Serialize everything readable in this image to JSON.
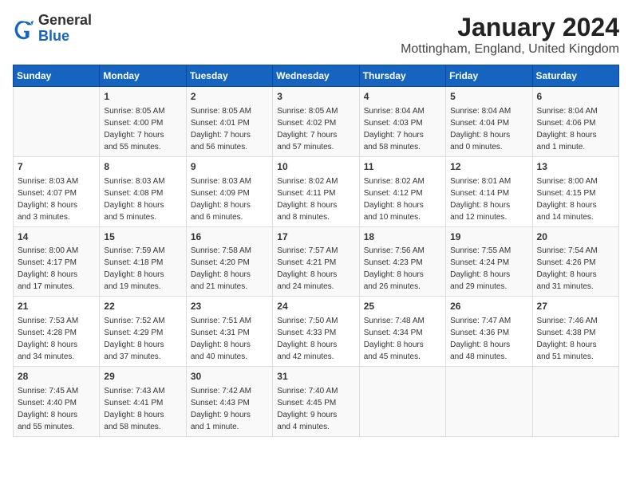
{
  "header": {
    "logo_general": "General",
    "logo_blue": "Blue",
    "month_title": "January 2024",
    "location": "Mottingham, England, United Kingdom"
  },
  "days_of_week": [
    "Sunday",
    "Monday",
    "Tuesday",
    "Wednesday",
    "Thursday",
    "Friday",
    "Saturday"
  ],
  "weeks": [
    [
      {
        "day": "",
        "info": ""
      },
      {
        "day": "1",
        "info": "Sunrise: 8:05 AM\nSunset: 4:00 PM\nDaylight: 7 hours\nand 55 minutes."
      },
      {
        "day": "2",
        "info": "Sunrise: 8:05 AM\nSunset: 4:01 PM\nDaylight: 7 hours\nand 56 minutes."
      },
      {
        "day": "3",
        "info": "Sunrise: 8:05 AM\nSunset: 4:02 PM\nDaylight: 7 hours\nand 57 minutes."
      },
      {
        "day": "4",
        "info": "Sunrise: 8:04 AM\nSunset: 4:03 PM\nDaylight: 7 hours\nand 58 minutes."
      },
      {
        "day": "5",
        "info": "Sunrise: 8:04 AM\nSunset: 4:04 PM\nDaylight: 8 hours\nand 0 minutes."
      },
      {
        "day": "6",
        "info": "Sunrise: 8:04 AM\nSunset: 4:06 PM\nDaylight: 8 hours\nand 1 minute."
      }
    ],
    [
      {
        "day": "7",
        "info": "Sunrise: 8:03 AM\nSunset: 4:07 PM\nDaylight: 8 hours\nand 3 minutes."
      },
      {
        "day": "8",
        "info": "Sunrise: 8:03 AM\nSunset: 4:08 PM\nDaylight: 8 hours\nand 5 minutes."
      },
      {
        "day": "9",
        "info": "Sunrise: 8:03 AM\nSunset: 4:09 PM\nDaylight: 8 hours\nand 6 minutes."
      },
      {
        "day": "10",
        "info": "Sunrise: 8:02 AM\nSunset: 4:11 PM\nDaylight: 8 hours\nand 8 minutes."
      },
      {
        "day": "11",
        "info": "Sunrise: 8:02 AM\nSunset: 4:12 PM\nDaylight: 8 hours\nand 10 minutes."
      },
      {
        "day": "12",
        "info": "Sunrise: 8:01 AM\nSunset: 4:14 PM\nDaylight: 8 hours\nand 12 minutes."
      },
      {
        "day": "13",
        "info": "Sunrise: 8:00 AM\nSunset: 4:15 PM\nDaylight: 8 hours\nand 14 minutes."
      }
    ],
    [
      {
        "day": "14",
        "info": "Sunrise: 8:00 AM\nSunset: 4:17 PM\nDaylight: 8 hours\nand 17 minutes."
      },
      {
        "day": "15",
        "info": "Sunrise: 7:59 AM\nSunset: 4:18 PM\nDaylight: 8 hours\nand 19 minutes."
      },
      {
        "day": "16",
        "info": "Sunrise: 7:58 AM\nSunset: 4:20 PM\nDaylight: 8 hours\nand 21 minutes."
      },
      {
        "day": "17",
        "info": "Sunrise: 7:57 AM\nSunset: 4:21 PM\nDaylight: 8 hours\nand 24 minutes."
      },
      {
        "day": "18",
        "info": "Sunrise: 7:56 AM\nSunset: 4:23 PM\nDaylight: 8 hours\nand 26 minutes."
      },
      {
        "day": "19",
        "info": "Sunrise: 7:55 AM\nSunset: 4:24 PM\nDaylight: 8 hours\nand 29 minutes."
      },
      {
        "day": "20",
        "info": "Sunrise: 7:54 AM\nSunset: 4:26 PM\nDaylight: 8 hours\nand 31 minutes."
      }
    ],
    [
      {
        "day": "21",
        "info": "Sunrise: 7:53 AM\nSunset: 4:28 PM\nDaylight: 8 hours\nand 34 minutes."
      },
      {
        "day": "22",
        "info": "Sunrise: 7:52 AM\nSunset: 4:29 PM\nDaylight: 8 hours\nand 37 minutes."
      },
      {
        "day": "23",
        "info": "Sunrise: 7:51 AM\nSunset: 4:31 PM\nDaylight: 8 hours\nand 40 minutes."
      },
      {
        "day": "24",
        "info": "Sunrise: 7:50 AM\nSunset: 4:33 PM\nDaylight: 8 hours\nand 42 minutes."
      },
      {
        "day": "25",
        "info": "Sunrise: 7:48 AM\nSunset: 4:34 PM\nDaylight: 8 hours\nand 45 minutes."
      },
      {
        "day": "26",
        "info": "Sunrise: 7:47 AM\nSunset: 4:36 PM\nDaylight: 8 hours\nand 48 minutes."
      },
      {
        "day": "27",
        "info": "Sunrise: 7:46 AM\nSunset: 4:38 PM\nDaylight: 8 hours\nand 51 minutes."
      }
    ],
    [
      {
        "day": "28",
        "info": "Sunrise: 7:45 AM\nSunset: 4:40 PM\nDaylight: 8 hours\nand 55 minutes."
      },
      {
        "day": "29",
        "info": "Sunrise: 7:43 AM\nSunset: 4:41 PM\nDaylight: 8 hours\nand 58 minutes."
      },
      {
        "day": "30",
        "info": "Sunrise: 7:42 AM\nSunset: 4:43 PM\nDaylight: 9 hours\nand 1 minute."
      },
      {
        "day": "31",
        "info": "Sunrise: 7:40 AM\nSunset: 4:45 PM\nDaylight: 9 hours\nand 4 minutes."
      },
      {
        "day": "",
        "info": ""
      },
      {
        "day": "",
        "info": ""
      },
      {
        "day": "",
        "info": ""
      }
    ]
  ]
}
